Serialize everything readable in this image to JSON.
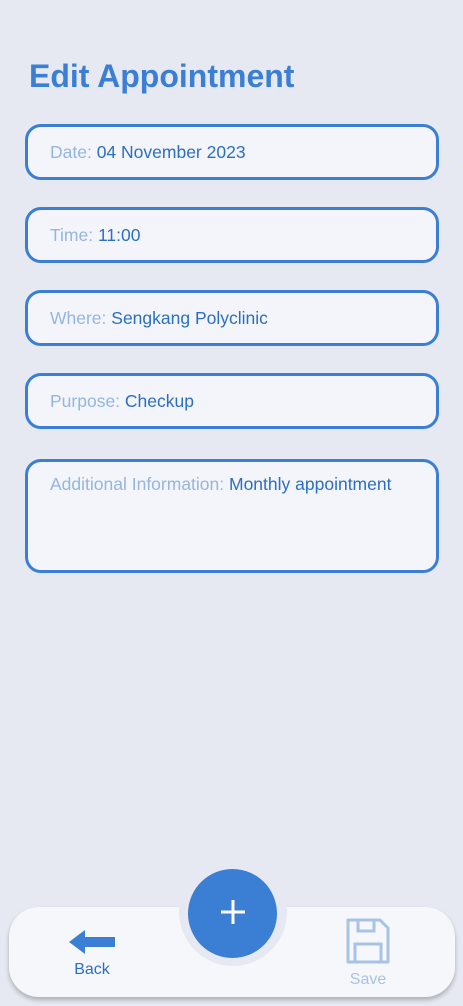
{
  "header": {
    "title": "Edit Appointment"
  },
  "form": {
    "date": {
      "label": "Date: ",
      "value": "04 November 2023"
    },
    "time": {
      "label": "Time: ",
      "value": "11:00"
    },
    "where": {
      "label": "Where: ",
      "value": "Sengkang Polyclinic"
    },
    "purpose": {
      "label": "Purpose: ",
      "value": "Checkup"
    },
    "info": {
      "label": "Additional Information: ",
      "value": "Monthly appointment"
    }
  },
  "nav": {
    "back_label": "Back",
    "save_label": "Save",
    "add_icon": "plus-icon"
  },
  "colors": {
    "accent": "#3a7fd4",
    "background": "#e6e9f2",
    "label": "#94b6e0",
    "disabled": "#a9c3e6"
  }
}
